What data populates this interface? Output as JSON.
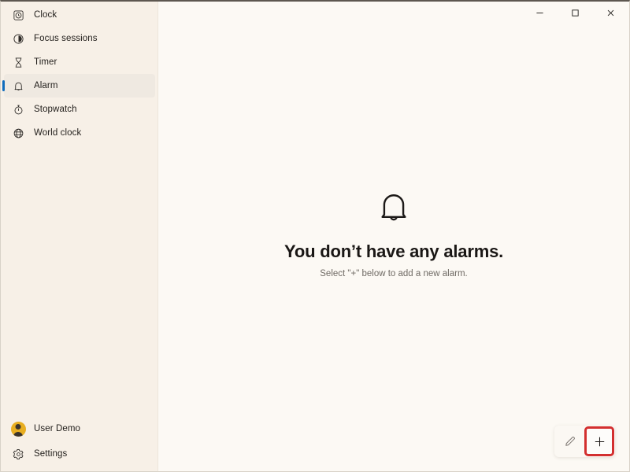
{
  "app": {
    "title": "Clock",
    "title_icon": "clock-app-icon"
  },
  "titlebar": {
    "minimize_label": "─",
    "maximize_label": "□",
    "close_label": "✕"
  },
  "sidebar": {
    "items": [
      {
        "label": "Focus sessions",
        "icon": "focus-sessions-icon",
        "selected": false
      },
      {
        "label": "Timer",
        "icon": "hourglass-icon",
        "selected": false
      },
      {
        "label": "Alarm",
        "icon": "bell-icon",
        "selected": true
      },
      {
        "label": "Stopwatch",
        "icon": "stopwatch-icon",
        "selected": false
      },
      {
        "label": "World clock",
        "icon": "globe-icon",
        "selected": false
      }
    ],
    "bottom": {
      "user_label": "User Demo",
      "user_icon": "avatar-icon",
      "settings_label": "Settings",
      "settings_icon": "gear-icon"
    }
  },
  "main": {
    "empty_state": {
      "icon": "bell-icon",
      "title": "You don’t have any alarms.",
      "subtitle": "Select \"+\" below to add a new alarm."
    },
    "command_bar": {
      "edit_label": "",
      "edit_icon": "pencil-icon",
      "add_label": "+",
      "add_icon": "plus-icon"
    }
  },
  "colors": {
    "accent": "#0f6cbd",
    "sidebar_bg": "#f7f0e7",
    "main_bg": "#fcf9f4",
    "highlight_border": "#d32f2f",
    "avatar_bg": "#e8ae21"
  }
}
